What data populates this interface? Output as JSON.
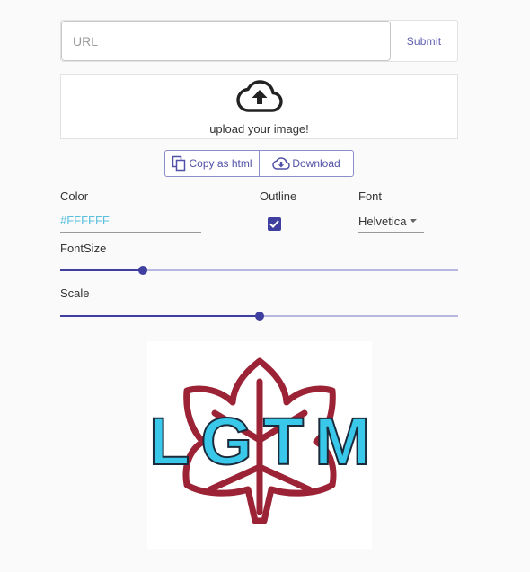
{
  "url_bar": {
    "placeholder": "URL",
    "value": "",
    "submit_label": "Submit"
  },
  "upload": {
    "icon": "cloud-upload-icon",
    "label": "upload your image!"
  },
  "actions": {
    "copy_html": {
      "icon": "copy-icon",
      "label": "Copy as html"
    },
    "download": {
      "icon": "cloud-download-icon",
      "label": "Download"
    }
  },
  "controls": {
    "color": {
      "label": "Color",
      "value": "#FFFFFF"
    },
    "outline": {
      "label": "Outline",
      "checked": true
    },
    "font": {
      "label": "Font",
      "value": "Helvetica"
    },
    "font_size": {
      "label": "FontSize",
      "fraction": 0.207
    },
    "scale": {
      "label": "Scale",
      "fraction": 0.5
    }
  },
  "preview": {
    "text": "LGTM",
    "text_color": "#3ac8ea",
    "outline_color": "#1a2a3a",
    "leaf_color": "#9b2335"
  },
  "colors": {
    "accent": "#3f3fa0",
    "accent_light": "#b7b7e2",
    "button_text": "#5050a8",
    "color_value": "#5bc0de"
  }
}
